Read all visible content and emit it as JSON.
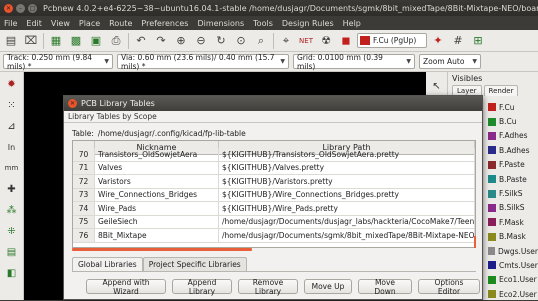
{
  "window": {
    "title": "Pcbnew 4.0.2+e4-6225~38~ubuntu16.04.1-stable /home/dusjagr/Documents/sgmk/8bit_mixedTape/8Bit-Mixtape-NEO/boards/DIMI-8..."
  },
  "menu": [
    "File",
    "Edit",
    "View",
    "Place",
    "Route",
    "Preferences",
    "Dimensions",
    "Tools",
    "Design Rules",
    "Help"
  ],
  "toolbar": {
    "layer": "F.Cu (PgUp)",
    "icons": [
      "new-board-icon",
      "open-icon",
      "save-icon",
      "page-settings-icon",
      "module-editor-icon",
      "library-browser-icon",
      "print-icon",
      "plot-icon",
      "zoom-in-icon",
      "zoom-out-icon",
      "zoom-redraw-icon",
      "zoom-fit-icon",
      "zoom-selection-icon",
      "find-icon",
      "netlist-icon",
      "drc-icon",
      "layer-pair-icon",
      "python-icon",
      "grid-icon",
      "microwave-icon"
    ]
  },
  "toolbar2": {
    "track": "Track: 0.250 mm (9.84 mils) *",
    "via": "Via: 0.60 mm (23.6 mils)/ 0.40 mm (15.7 mils) *",
    "grid": "Grid: 0.0100 mm (0.39 mils)",
    "zoom": "Zoom Auto"
  },
  "layers_panel": {
    "title": "Visibles",
    "tabs": [
      "Layer",
      "Render"
    ],
    "items": [
      {
        "name": "F.Cu",
        "color": "#c0211d"
      },
      {
        "name": "B.Cu",
        "color": "#1e8a2e"
      },
      {
        "name": "F.Adhes",
        "color": "#8a2a8a"
      },
      {
        "name": "B.Adhes",
        "color": "#2a2a8a"
      },
      {
        "name": "F.Paste",
        "color": "#8a2a2a"
      },
      {
        "name": "B.Paste",
        "color": "#1e8a8a"
      },
      {
        "name": "F.SilkS",
        "color": "#2a8a8a"
      },
      {
        "name": "B.SilkS",
        "color": "#8a2a8a"
      },
      {
        "name": "F.Mask",
        "color": "#8a1e5a"
      },
      {
        "name": "B.Mask",
        "color": "#8a8a1e"
      },
      {
        "name": "Dwgs.User",
        "color": "#8a8a8a"
      },
      {
        "name": "Cmts.User",
        "color": "#1e1e8a"
      },
      {
        "name": "Eco1.User",
        "color": "#1e8a1e"
      },
      {
        "name": "Eco2.User",
        "color": "#8a8a1e"
      }
    ]
  },
  "dialog": {
    "title": "PCB Library Tables",
    "group": "Library Tables by Scope",
    "table_label": "Table:",
    "table_path": "/home/dusjagr/.config/kicad/fp-lib-table",
    "columns": {
      "nickname": "Nickname",
      "path": "Library Path"
    },
    "rows": [
      {
        "num": "70",
        "nick": "Transistors_OldSowjetAera",
        "path": "${KIGITHUB}/Transistors_OldSowjetAera.pretty"
      },
      {
        "num": "71",
        "nick": "Valves",
        "path": "${KIGITHUB}/Valves.pretty"
      },
      {
        "num": "72",
        "nick": "Varistors",
        "path": "${KIGITHUB}/Varistors.pretty"
      },
      {
        "num": "73",
        "nick": "Wire_Connections_Bridges",
        "path": "${KIGITHUB}/Wire_Connections_Bridges.pretty"
      },
      {
        "num": "74",
        "nick": "Wire_Pads",
        "path": "${KIGITHUB}/Wire_Pads.pretty"
      },
      {
        "num": "75",
        "nick": "GeileSiech",
        "path": "/home/dusjagr/Documents/dusjagr_labs/hackteria/CocoMake7/Teens7Coco"
      },
      {
        "num": "76",
        "nick": "8Bit_Mixtape",
        "path": "/home/dusjagr/Documents/sgmk/8bit_mixedTape/8Bit-Mixtape-NEO/boards"
      }
    ],
    "tabs": [
      "Global Libraries",
      "Project Specific Libraries"
    ],
    "buttons": [
      "Append with Wizard",
      "Append Library",
      "Remove Library",
      "Move Up",
      "Move Down",
      "Options Editor"
    ]
  }
}
